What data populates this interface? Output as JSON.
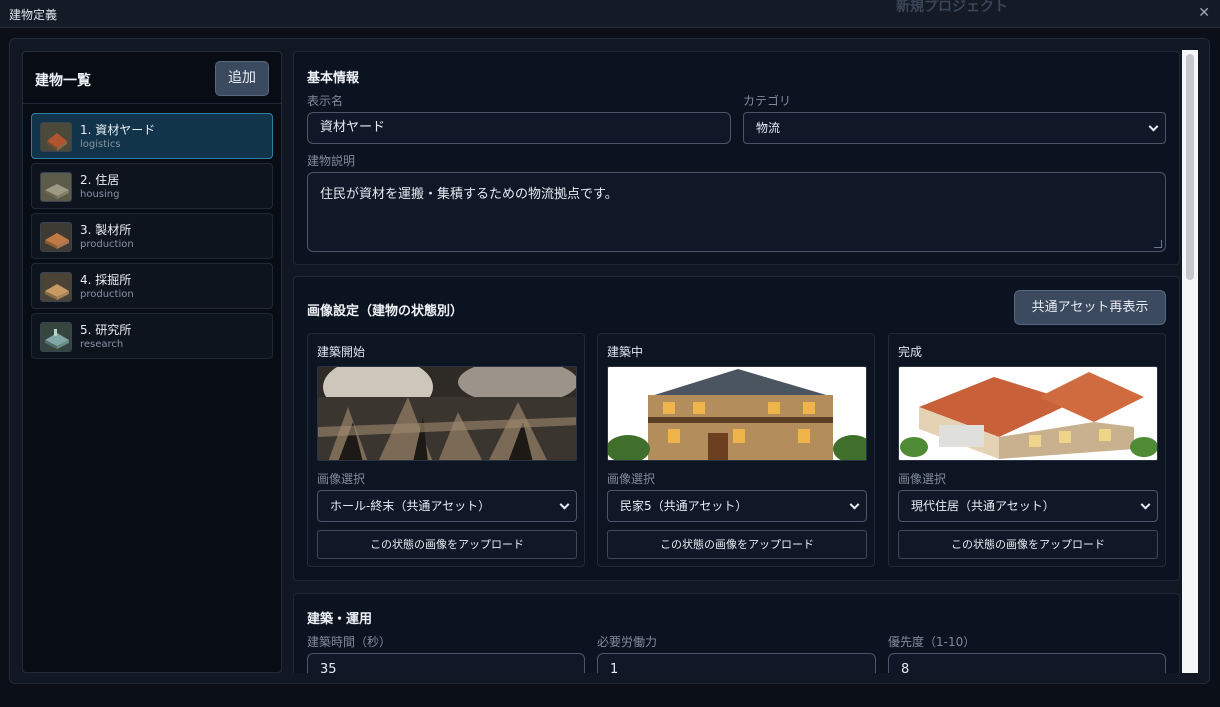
{
  "window": {
    "title": "建物定義",
    "background_title": "新規プロジェクト"
  },
  "left": {
    "title": "建物一覧",
    "add_label": "追加",
    "items": [
      {
        "name": "1. 資材ヤード",
        "category": "logistics",
        "active": true
      },
      {
        "name": "2. 住居",
        "category": "housing",
        "active": false
      },
      {
        "name": "3. 製材所",
        "category": "production",
        "active": false
      },
      {
        "name": "4. 採掘所",
        "category": "production",
        "active": false
      },
      {
        "name": "5. 研究所",
        "category": "research",
        "active": false
      }
    ]
  },
  "basic": {
    "title": "基本情報",
    "display_name_label": "表示名",
    "display_name_value": "資材ヤード",
    "category_label": "カテゴリ",
    "category_value": "物流",
    "description_label": "建物説明",
    "description_value": "住民が資材を運搬・集積するための物流拠点です。"
  },
  "images": {
    "title": "画像設定（建物の状態別）",
    "reshow_label": "共通アセット再表示",
    "image_select_label": "画像選択",
    "upload_label": "この状態の画像をアップロード",
    "states": [
      {
        "title": "建築開始",
        "selected": "ホール-終末（共通アセット）"
      },
      {
        "title": "建築中",
        "selected": "民家5（共通アセット）"
      },
      {
        "title": "完成",
        "selected": "現代住居（共通アセット）"
      }
    ]
  },
  "construction": {
    "title": "建築・運用",
    "build_time_label": "建築時間（秒）",
    "build_time_value": "35",
    "labor_label": "必要労働力",
    "labor_value": "1",
    "priority_label": "優先度（1-10）",
    "priority_value": "8"
  },
  "colors": {
    "accent": "#2c7f9e",
    "button": "#3c4a5f",
    "panel": "#0c1320"
  }
}
